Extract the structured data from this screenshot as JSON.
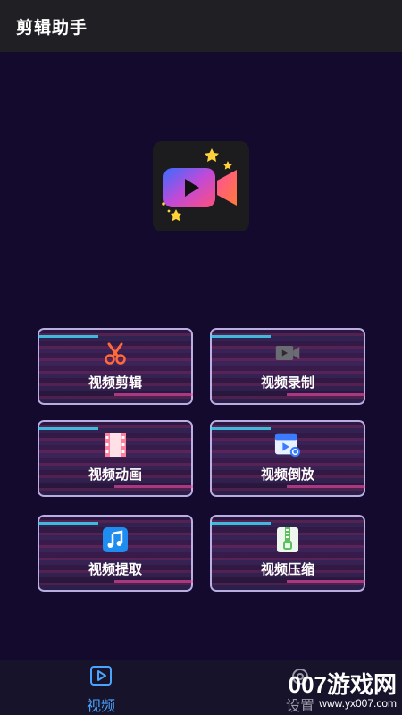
{
  "appbar": {
    "title": "剪辑助手"
  },
  "logo": {
    "icon": "video-camera-play-icon"
  },
  "cards": [
    {
      "label": "视频剪辑",
      "icon": "scissors-icon"
    },
    {
      "label": "视频录制",
      "icon": "video-camera-icon"
    },
    {
      "label": "视频动画",
      "icon": "film-strip-icon"
    },
    {
      "label": "视频倒放",
      "icon": "reverse-video-icon"
    },
    {
      "label": "视频提取",
      "icon": "music-note-icon"
    },
    {
      "label": "视频压缩",
      "icon": "zip-file-icon"
    }
  ],
  "bottomnav": {
    "items": [
      {
        "label": "视频",
        "icon": "play-square-icon",
        "active": true
      },
      {
        "label": "设置",
        "icon": "settings-icon",
        "active": false
      }
    ]
  },
  "watermark": {
    "big": "007游戏网",
    "small": "www.yx007.com"
  },
  "colors": {
    "background": "#130a2d",
    "appbar": "#201f24",
    "accent": "#4aa3ff"
  }
}
